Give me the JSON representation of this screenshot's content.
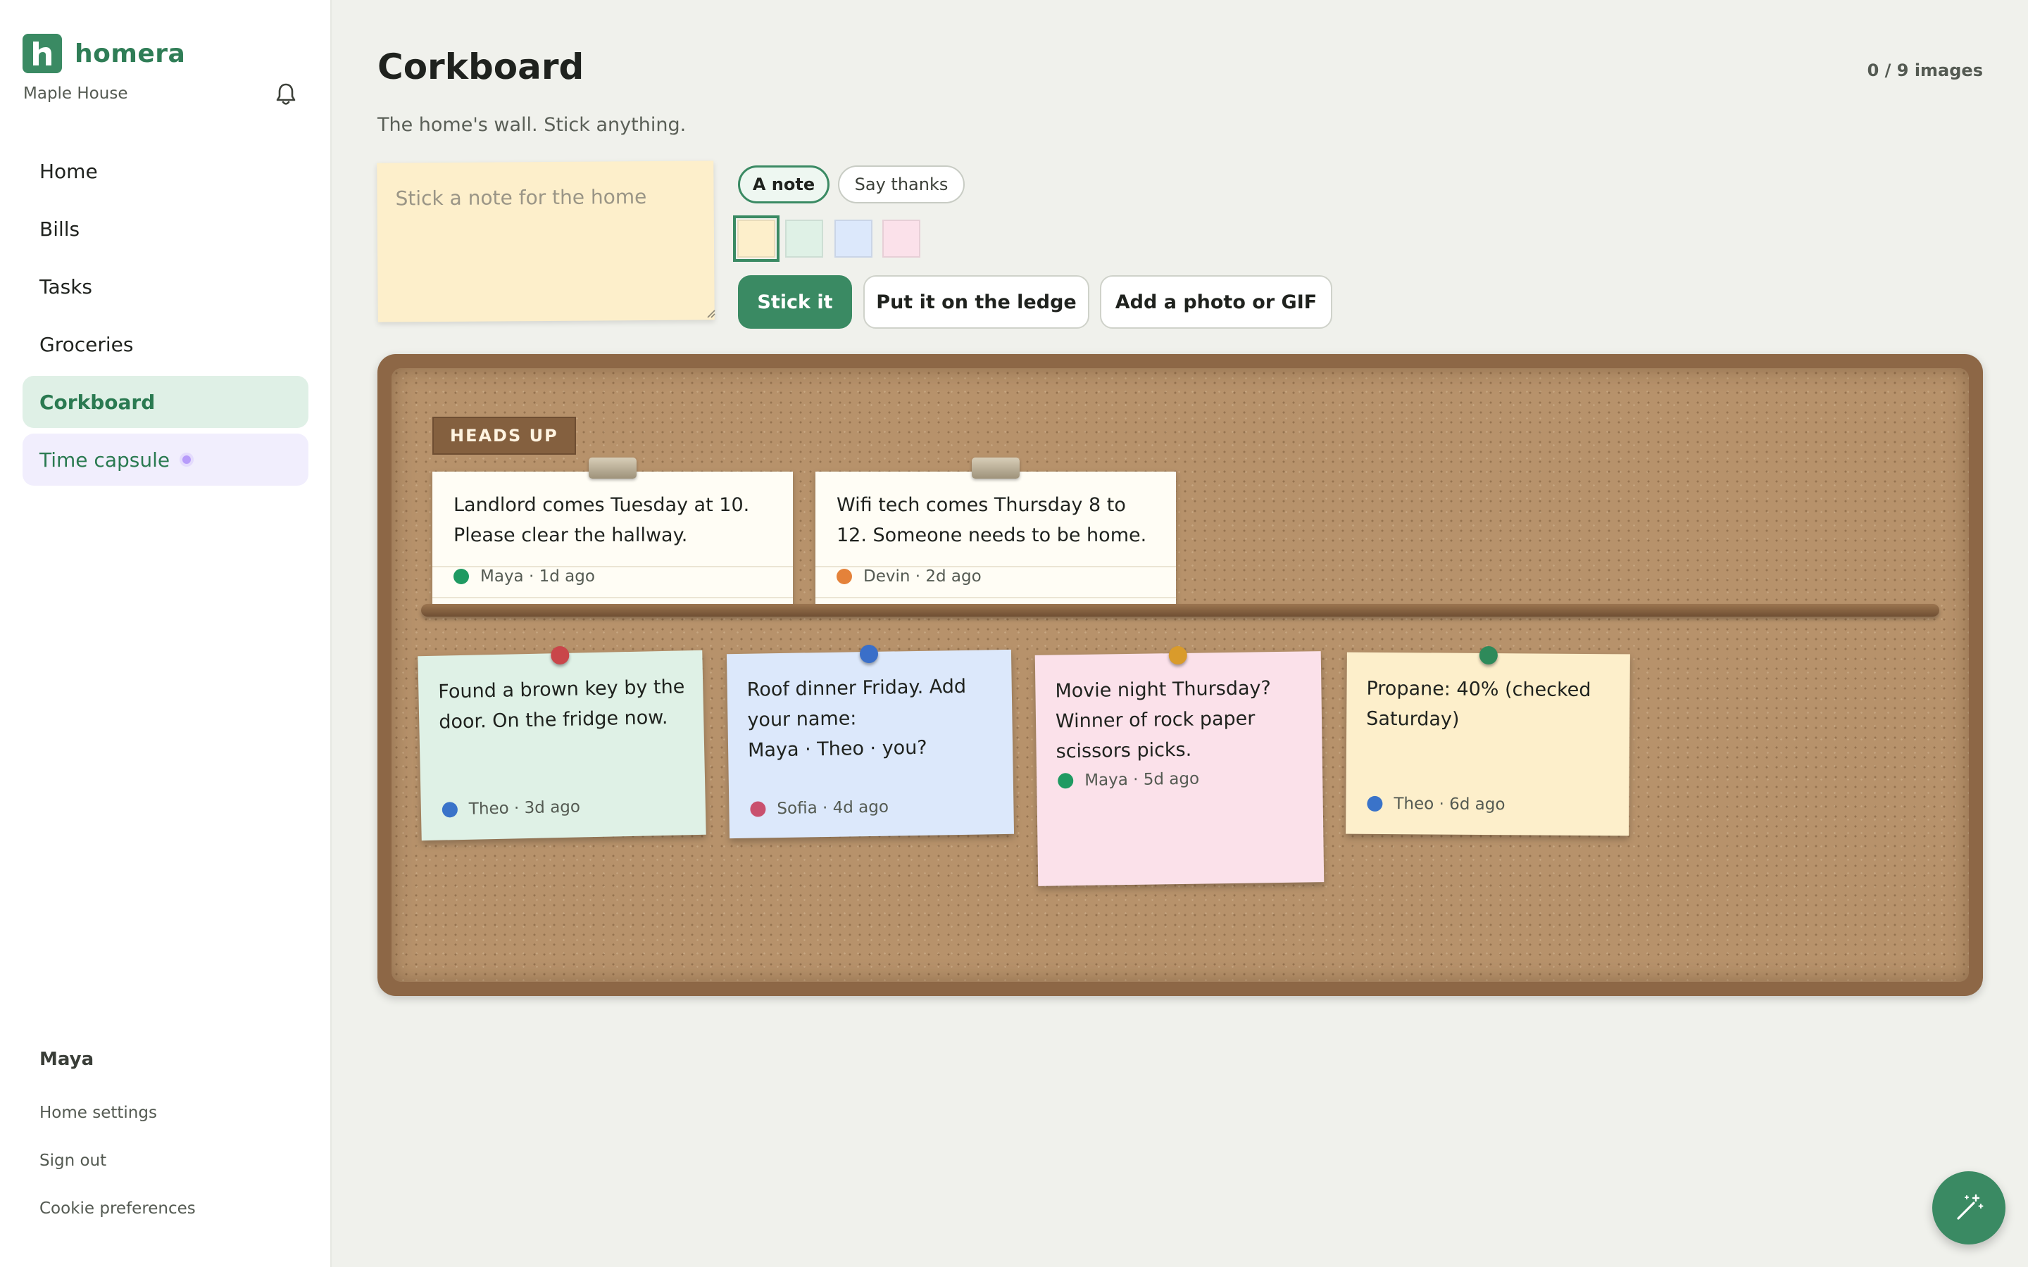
{
  "brand": {
    "name": "homera",
    "home_name": "Maple House"
  },
  "nav": {
    "items": [
      {
        "label": "Home"
      },
      {
        "label": "Bills"
      },
      {
        "label": "Tasks"
      },
      {
        "label": "Groceries"
      },
      {
        "label": "Corkboard",
        "active": true
      },
      {
        "label": "Time capsule"
      }
    ]
  },
  "account": {
    "user": "Maya",
    "links": [
      "Home settings",
      "Sign out",
      "Cookie preferences"
    ]
  },
  "header": {
    "title": "Corkboard",
    "subtitle": "The home's wall. Stick anything.",
    "image_count": "0 / 9 images"
  },
  "composer": {
    "placeholder": "Stick a note for the home",
    "modes": [
      "A note",
      "Say thanks"
    ],
    "selected_mode": "A note",
    "swatches": [
      "#fdefcb",
      "#dff1e6",
      "#dce8fb",
      "#fbe1ea"
    ],
    "selected_swatch": "#fdefcb",
    "buttons": {
      "stick": "Stick it",
      "ledge": "Put it on the ledge",
      "media": "Add a photo or GIF"
    }
  },
  "board": {
    "heads_up_label": "HEADS UP",
    "ledge_notes": [
      {
        "text": "Landlord comes Tuesday at 10. Please clear the hallway.",
        "author": "Maya",
        "meta": "Maya · 1d ago",
        "dot_color": "#1f9a62"
      },
      {
        "text": "Wifi tech comes Thursday 8 to 12. Someone needs to be home.",
        "author": "Devin",
        "meta": "Devin · 2d ago",
        "dot_color": "#e4823a"
      }
    ],
    "pinned_notes": [
      {
        "text": "Found a brown key by the door. On the fridge now.",
        "meta": "Theo · 3d ago",
        "color": "#dff1e6",
        "pin_color": "#c9464a",
        "dot_color": "#3a73c9"
      },
      {
        "text": "Roof dinner Friday. Add your name:\nMaya · Theo · you?",
        "meta": "Sofia · 4d ago",
        "color": "#dce8fb",
        "pin_color": "#3a6fc9",
        "dot_color": "#c9506e"
      },
      {
        "text": "Movie night Thursday? Winner of rock paper scissors picks.",
        "meta": "Maya · 5d ago",
        "color": "#fbe1ea",
        "pin_color": "#d99b2b",
        "dot_color": "#1f9a62"
      },
      {
        "text": "Propane: 40% (checked Saturday)",
        "meta": "Theo · 6d ago",
        "color": "#fdefcb",
        "pin_color": "#2e8a5a",
        "dot_color": "#3a73c9"
      }
    ]
  },
  "colors": {
    "accent": "#3a8a63",
    "cork": "#b7926b",
    "frame": "#8d6746"
  }
}
